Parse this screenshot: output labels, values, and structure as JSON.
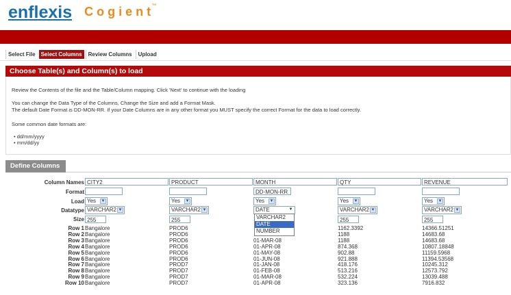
{
  "logo": {
    "brand": "enflexis",
    "product": "Cogient",
    "tm": "™"
  },
  "tabs": [
    "Select File",
    "Select Columns",
    "Review Columns",
    "Upload"
  ],
  "panel": {
    "title": "Choose Table(s) and Column(s) to load",
    "line1": "Review the Contents of the file and the Table/Column mapping. Click 'Next' to continue with the loading",
    "line2": "You can change the Data Type of the Columns, Change the Size and add a Format Mask.",
    "line3": "The default Date Format is DD-MON-RR. If your Date Columns are in any other format you MUST specify the correct Format for the data to load correctly.",
    "line4": "Some common date formats are:",
    "bullets": [
      "dd/mm/yyyy",
      "mm/dd/yy"
    ]
  },
  "define": {
    "title": "Define Columns",
    "labels": {
      "names": "Column Names",
      "format": "Format",
      "load": "Load",
      "datatype": "Datatype",
      "size": "Size"
    },
    "columns": [
      {
        "name": "CITY2",
        "format": "",
        "load": "Yes",
        "datatype": "VARCHAR2",
        "size": "255"
      },
      {
        "name": "PRODUCT",
        "format": "",
        "load": "Yes",
        "datatype": "VARCHAR2",
        "size": "255"
      },
      {
        "name": "MONTH",
        "format": "DD-MON-RR",
        "load": "Yes",
        "datatype": "DATE",
        "size": ""
      },
      {
        "name": "QTY",
        "format": "",
        "load": "Yes",
        "datatype": "VARCHAR2",
        "size": "255"
      },
      {
        "name": "REVENUE",
        "format": "",
        "load": "Yes",
        "datatype": "VARCHAR2",
        "size": "255"
      }
    ],
    "dropdown_options": [
      "VARCHAR2",
      "DATE",
      "NUMBER"
    ],
    "rows": [
      {
        "label": "Row 1",
        "cells": [
          "Bangalore",
          "PROD6",
          "",
          "1162.3392",
          "14366.51251"
        ]
      },
      {
        "label": "Row 2",
        "cells": [
          "Bangalore",
          "PROD6",
          "",
          "1188",
          "14683.68"
        ]
      },
      {
        "label": "Row 3",
        "cells": [
          "Bangalore",
          "PROD6",
          "01-MAR-08",
          "1188",
          "14683.68"
        ]
      },
      {
        "label": "Row 4",
        "cells": [
          "Bangalore",
          "PROD6",
          "01-APR-08",
          "874.368",
          "10807.18848"
        ]
      },
      {
        "label": "Row 5",
        "cells": [
          "Bangalore",
          "PROD6",
          "01-MAY-08",
          "902.88",
          "11159.5968"
        ]
      },
      {
        "label": "Row 6",
        "cells": [
          "Bangalore",
          "PROD6",
          "01-JUN-08",
          "921.888",
          "11394.53568"
        ]
      },
      {
        "label": "Row 7",
        "cells": [
          "Bangalore",
          "PROD7",
          "01-JAN-08",
          "418.176",
          "10245.312"
        ]
      },
      {
        "label": "Row 8",
        "cells": [
          "Bangalore",
          "PROD7",
          "01-FEB-08",
          "513.216",
          "12573.792"
        ]
      },
      {
        "label": "Row 9",
        "cells": [
          "Bangalore",
          "PROD7",
          "01-MAR-08",
          "532.224",
          "13039.488"
        ]
      },
      {
        "label": "Row 10",
        "cells": [
          "Bangalore",
          "PROD7",
          "01-APR-08",
          "323.136",
          "7916.832"
        ]
      }
    ]
  },
  "colors": {
    "red": "#b20000",
    "tab_active": "#a01010",
    "brand_blue": "#1a6fae",
    "brand_orange": "#e98b1a",
    "dropdown_highlight": "#3a6bc4"
  }
}
